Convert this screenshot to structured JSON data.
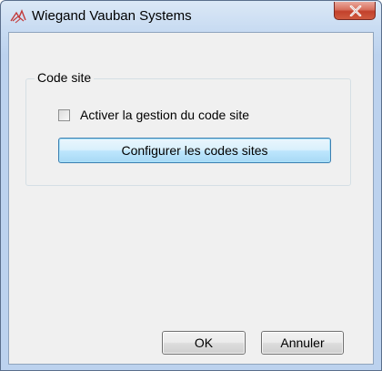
{
  "window": {
    "title": "Wiegand Vauban Systems",
    "app_icon": "vauban-logo-icon",
    "close_icon": "close-icon",
    "accent_color": "#c2412c"
  },
  "group": {
    "label": "Code site",
    "checkbox_label": "Activer la gestion du code site",
    "checkbox_checked": false,
    "configure_button": "Configurer les codes sites"
  },
  "footer": {
    "ok_label": "OK",
    "cancel_label": "Annuler"
  }
}
